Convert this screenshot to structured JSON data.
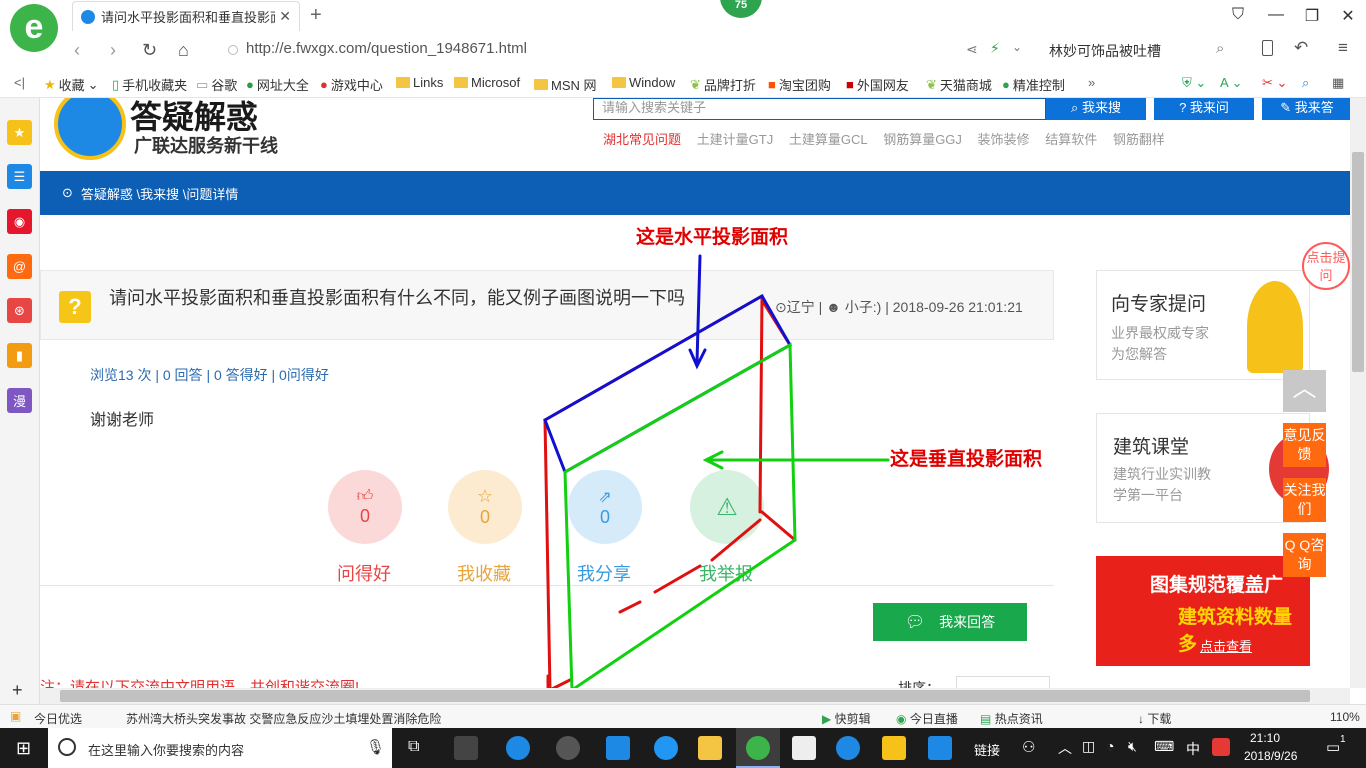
{
  "browser": {
    "tab_title": "请问水平投影面积和垂直投影面",
    "badge": "75",
    "url": "http://e.fwxgx.com/question_1948671.html",
    "search_hint": "林妙可饰品被吐槽",
    "bookmarks": [
      "收藏",
      "手机收藏夹",
      "谷歌",
      "网址大全",
      "游戏中心",
      "Links",
      "Microsof",
      "MSN 网",
      "Window",
      "品牌打折",
      "淘宝团购",
      "外国网友",
      "天猫商城",
      "精准控制"
    ]
  },
  "site": {
    "logo_title": "答疑解惑",
    "logo_sub": "广联达服务新干线",
    "search_placeholder": "请输入搜索关键子",
    "btn_search": "我来搜",
    "btn_ask": "我来问",
    "btn_answer_top": "我来答",
    "categories": [
      "湖北常见问题",
      "土建计量GTJ",
      "土建算量GCL",
      "钢筋算量GGJ",
      "装饰装修",
      "结算软件",
      "钢筋翻样"
    ],
    "breadcrumb": "答疑解惑 \\我来搜 \\问题详情"
  },
  "question": {
    "title": "请问水平投影面积和垂直投影面积有什么不同，能又例子画图说明一下吗",
    "province": "辽宁",
    "user": "小子:)",
    "datetime": "2018-09-26 21:01:21",
    "stats": "浏览13 次 | 0 回答 | 0 答得好 | 0问得好",
    "body": "谢谢老师",
    "actions": [
      {
        "label": "问得好",
        "count": "0",
        "color": "#e84545",
        "bg": "#fbd9d9"
      },
      {
        "label": "我收藏",
        "count": "0",
        "color": "#e8a43c",
        "bg": "#fcebd0"
      },
      {
        "label": "我分享",
        "count": "0",
        "color": "#3a9ae0",
        "bg": "#d5ebfa"
      },
      {
        "label": "我举报",
        "count": "",
        "color": "#3cb46a",
        "bg": "#d7f1e0"
      }
    ],
    "answer_btn": "我来回答",
    "notice": "注：请在以下交流中文明用语，共创和谐交流圈!",
    "sort_label": "排序："
  },
  "annotations": {
    "horizontal": "这是水平投影面积",
    "vertical": "这是垂直投影面积"
  },
  "right": {
    "card1_title": "向专家提问",
    "card1_sub1": "业界最权威专家",
    "card1_sub2": "为您解答",
    "card2_title": "建筑课堂",
    "card2_sub1": "建筑行业实训教",
    "card2_sub2": "学第一平台",
    "ad_line1": "图集规范覆盖广",
    "ad_line2": "建筑资料数量多",
    "ad_btn": "点击查看",
    "bubble": "点击提问",
    "float_feedback": "意见反馈",
    "float_follow": "关注我们",
    "float_qq": "Q Q咨询"
  },
  "statusbar": {
    "left": "今日优选",
    "news": "苏州湾大桥头突发事故 交警应急反应沙土填埋处置消除危险",
    "items": [
      "快剪辑",
      "今日直播",
      "热点资讯",
      "下载"
    ],
    "zoom": "110%"
  },
  "taskbar": {
    "search_placeholder": "在这里输入你要搜索的内容",
    "links": "链接",
    "ime": "中",
    "time": "21:10",
    "date": "2018/9/26",
    "notify_count": "1"
  }
}
